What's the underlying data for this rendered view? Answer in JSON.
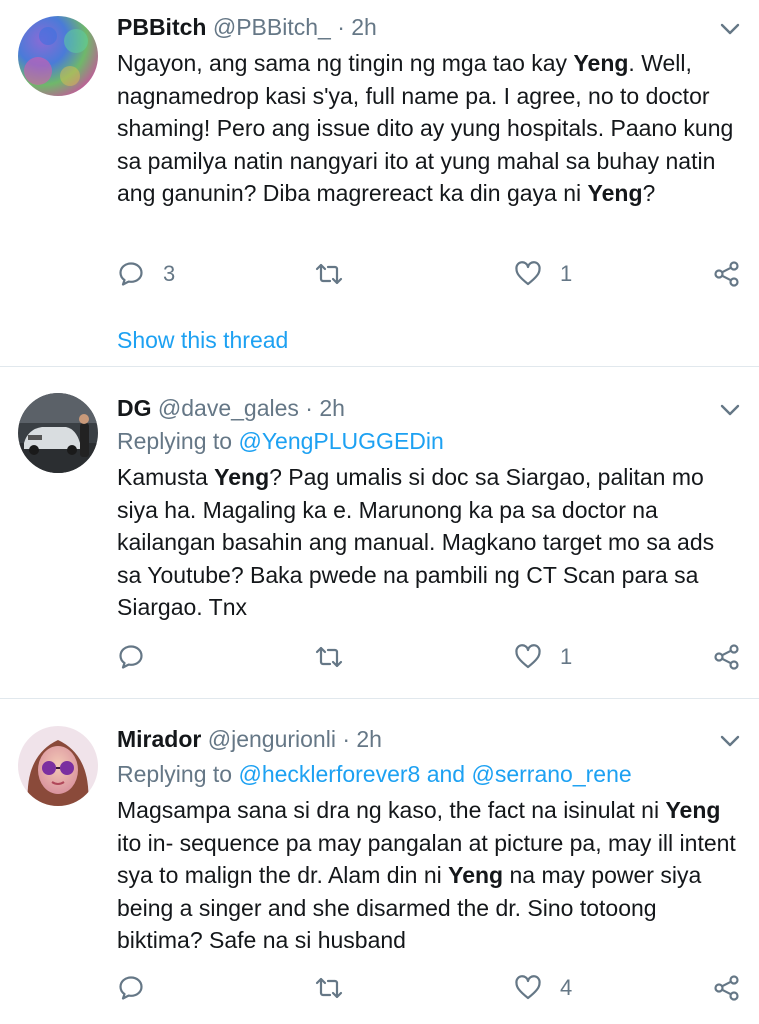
{
  "tweets": [
    {
      "name": "PBBitch",
      "handle": "@PBBitch_",
      "dot": "·",
      "time": "2h",
      "body_parts": [
        {
          "t": "Ngayon, ang sama ng tingin ng mga tao kay "
        },
        {
          "t": "Yeng",
          "b": true
        },
        {
          "t": ". Well, nagnamedrop kasi s'ya, full name pa. I agree, no to doctor shaming! Pero ang issue dito ay yung hospitals. Paano kung sa pamilya natin nangyari ito at yung mahal sa buhay natin ang ganunin? Diba magrereact ka din gaya ni "
        },
        {
          "t": "Yeng",
          "b": true
        },
        {
          "t": "?"
        }
      ],
      "reply_count": "3",
      "retweet_count": "",
      "like_count": "1",
      "show_thread": "Show this thread"
    },
    {
      "name": "DG",
      "handle": "@dave_gales",
      "dot": "·",
      "time": "2h",
      "replying_prefix": "Replying to",
      "replying_to": "@YengPLUGGEDin",
      "body_parts": [
        {
          "t": "Kamusta "
        },
        {
          "t": "Yeng",
          "b": true
        },
        {
          "t": "? Pag umalis si doc sa Siargao, palitan mo siya ha. Magaling ka e. Marunong ka pa sa doctor na kailangan basahin ang manual. Magkano target mo sa ads sa Youtube? Baka pwede na pambili ng CT Scan para sa Siargao. Tnx"
        }
      ],
      "reply_count": "",
      "retweet_count": "",
      "like_count": "1"
    },
    {
      "name": "Mirador",
      "handle": "@jengurionli",
      "dot": "·",
      "time": "2h",
      "replying_prefix": "Replying to",
      "replying_to": "@hecklerforever8 and @serrano_rene",
      "body_parts": [
        {
          "t": "Magsampa sana si dra ng kaso, the fact na isinulat ni "
        },
        {
          "t": "Yeng",
          "b": true
        },
        {
          "t": " ito in- sequence pa may pangalan at picture pa, may ill intent sya to malign the dr. Alam din ni "
        },
        {
          "t": "Yeng",
          "b": true
        },
        {
          "t": " na may power siya being a singer and she disarmed the dr. Sino totoong biktima? Safe na si husband"
        }
      ],
      "reply_count": "",
      "retweet_count": "",
      "like_count": "4"
    }
  ],
  "icons": {
    "reply": "reply-icon",
    "retweet": "retweet-icon",
    "like": "heart-icon",
    "share": "share-icon",
    "caret": "chevron-down-icon"
  },
  "colors": {
    "accent": "#1da1f2",
    "muted": "#657786",
    "divider": "#e1e8ed"
  }
}
